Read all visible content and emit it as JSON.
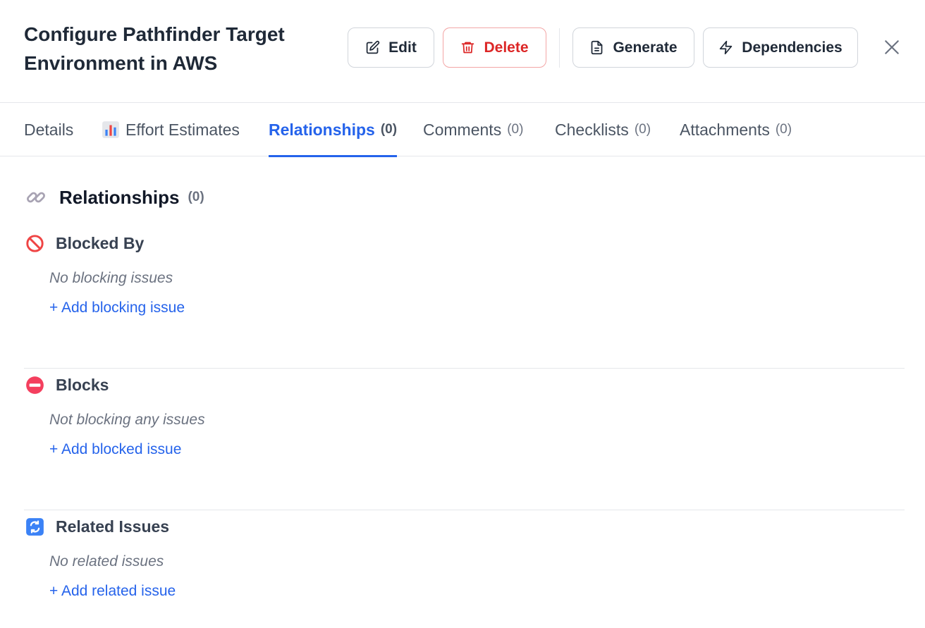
{
  "header": {
    "title": "Configure Pathfinder Target Environment in AWS",
    "buttons": {
      "edit": "Edit",
      "delete": "Delete",
      "generate": "Generate",
      "dependencies": "Dependencies"
    }
  },
  "tabs": [
    {
      "label": "Details",
      "count": ""
    },
    {
      "label": "Effort Estimates",
      "count": ""
    },
    {
      "label": "Relationships",
      "count": "(0)"
    },
    {
      "label": "Comments",
      "count": "(0)"
    },
    {
      "label": "Checklists",
      "count": "(0)"
    },
    {
      "label": "Attachments",
      "count": "(0)"
    }
  ],
  "active_tab": "Relationships",
  "section": {
    "title": "Relationships",
    "count": "(0)"
  },
  "groups": [
    {
      "title": "Blocked By",
      "empty": "No blocking issues",
      "add": "+ Add blocking issue",
      "icon": "prohibited-icon"
    },
    {
      "title": "Blocks",
      "empty": "Not blocking any issues",
      "add": "+ Add blocked issue",
      "icon": "no-entry-icon"
    },
    {
      "title": "Related Issues",
      "empty": "No related issues",
      "add": "+ Add related issue",
      "icon": "arrows-cycle-icon"
    }
  ],
  "colors": {
    "accent": "#2563eb",
    "danger": "#dc2626"
  }
}
